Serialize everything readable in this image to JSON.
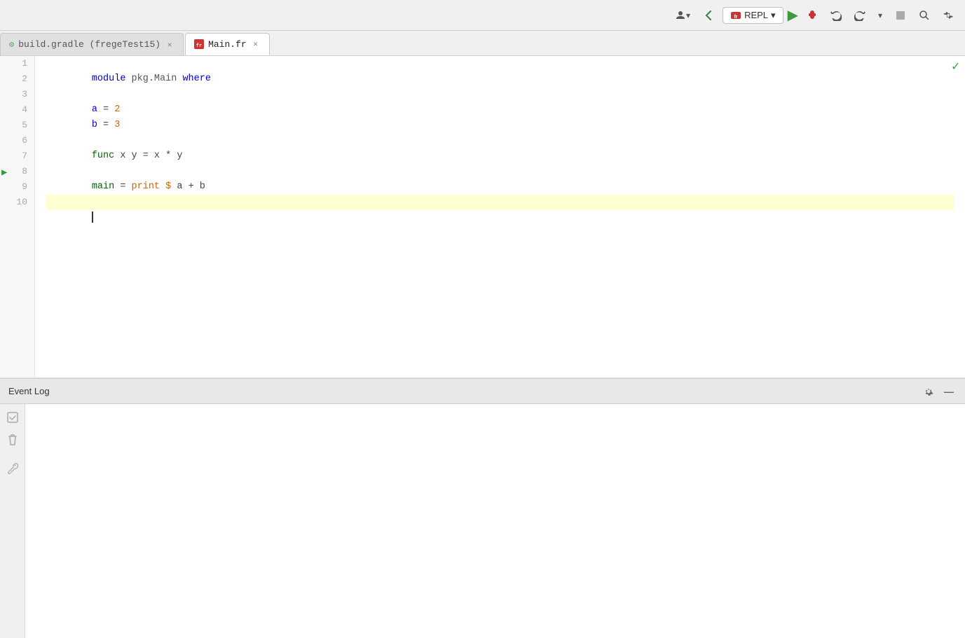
{
  "toolbar": {
    "repl_label": "REPL",
    "repl_dropdown_icon": "▾"
  },
  "tabs": [
    {
      "id": "build-gradle",
      "label": "build.gradle (fregeTest15)",
      "icon": "gradle-icon",
      "active": false,
      "closable": true
    },
    {
      "id": "main-fr",
      "label": "Main.fr",
      "icon": "frege-icon",
      "active": true,
      "closable": true
    }
  ],
  "editor": {
    "lines": [
      {
        "num": 1,
        "content": "module pkg.Main where",
        "tokens": [
          {
            "text": "module ",
            "class": "kw"
          },
          {
            "text": "pkg.Main",
            "class": "mod"
          },
          {
            "text": " ",
            "class": ""
          },
          {
            "text": "where",
            "class": "kw"
          }
        ],
        "gutter": null,
        "highlighted": false
      },
      {
        "num": 2,
        "content": "",
        "tokens": [],
        "gutter": null,
        "highlighted": false
      },
      {
        "num": 3,
        "content": "a = 2",
        "tokens": [
          {
            "text": "a",
            "class": "var-a"
          },
          {
            "text": " = ",
            "class": "op"
          },
          {
            "text": "2",
            "class": "num"
          }
        ],
        "gutter": null,
        "highlighted": false
      },
      {
        "num": 4,
        "content": "b = 3",
        "tokens": [
          {
            "text": "b",
            "class": "var-b"
          },
          {
            "text": " = ",
            "class": "op"
          },
          {
            "text": "3",
            "class": "num"
          }
        ],
        "gutter": null,
        "highlighted": false
      },
      {
        "num": 5,
        "content": "",
        "tokens": [],
        "gutter": null,
        "highlighted": false
      },
      {
        "num": 6,
        "content": "func x y = x * y",
        "tokens": [
          {
            "text": "func",
            "class": "fn-name"
          },
          {
            "text": " x y = x * y",
            "class": "op"
          }
        ],
        "gutter": null,
        "highlighted": false
      },
      {
        "num": 7,
        "content": "",
        "tokens": [],
        "gutter": null,
        "highlighted": false
      },
      {
        "num": 8,
        "content": "main = print $ a + b",
        "tokens": [
          {
            "text": "main",
            "class": "fn-name"
          },
          {
            "text": " = ",
            "class": "op"
          },
          {
            "text": "print",
            "class": "kw2"
          },
          {
            "text": " ",
            "class": ""
          },
          {
            "text": "$",
            "class": "dollar"
          },
          {
            "text": " a + b",
            "class": "op"
          }
        ],
        "gutter": "run",
        "highlighted": false
      },
      {
        "num": 9,
        "content": "",
        "tokens": [],
        "gutter": null,
        "highlighted": false
      },
      {
        "num": 10,
        "content": "",
        "tokens": [],
        "gutter": null,
        "highlighted": true
      }
    ],
    "check_mark": "✓",
    "cursor_visible": true
  },
  "event_log": {
    "title": "Event Log",
    "settings_icon": "⚙",
    "minimize_icon": "—"
  }
}
